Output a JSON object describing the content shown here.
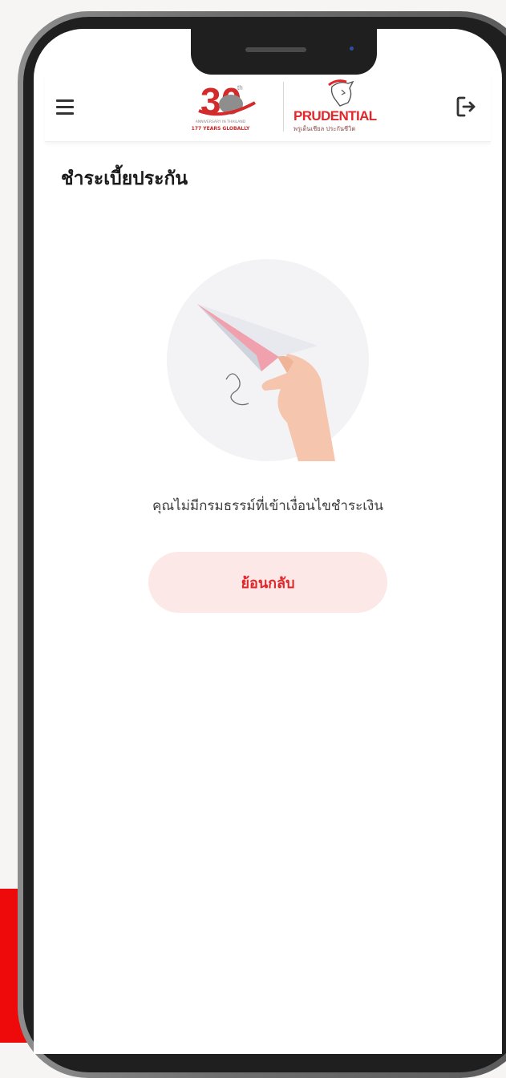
{
  "header": {
    "menu_icon": "hamburger-menu-icon",
    "logout_icon": "logout-icon",
    "anniversary_logo": {
      "number": "30",
      "superscript": "th",
      "caption": "ANNIVERSARY IN THAILAND",
      "tagline": "177 YEARS GLOBALLY"
    },
    "brand_logo": {
      "name": "PRUDENTIAL",
      "tagline": "พรูเด็นเชียล ประกันชีวิต"
    }
  },
  "page": {
    "title": "ชำระเบี้ยประกัน",
    "illustration": "paper-plane-hand-illustration",
    "empty_message": "คุณไม่มีกรมธรรม์ที่เข้าเงื่อนไขชำระเงิน",
    "back_button": "ย้อนกลับ"
  },
  "colors": {
    "brand_red": "#e0282b",
    "button_bg": "#fde8e8",
    "background_red": "#ee0a0a",
    "illustration_circle": "#f3f3f5"
  }
}
